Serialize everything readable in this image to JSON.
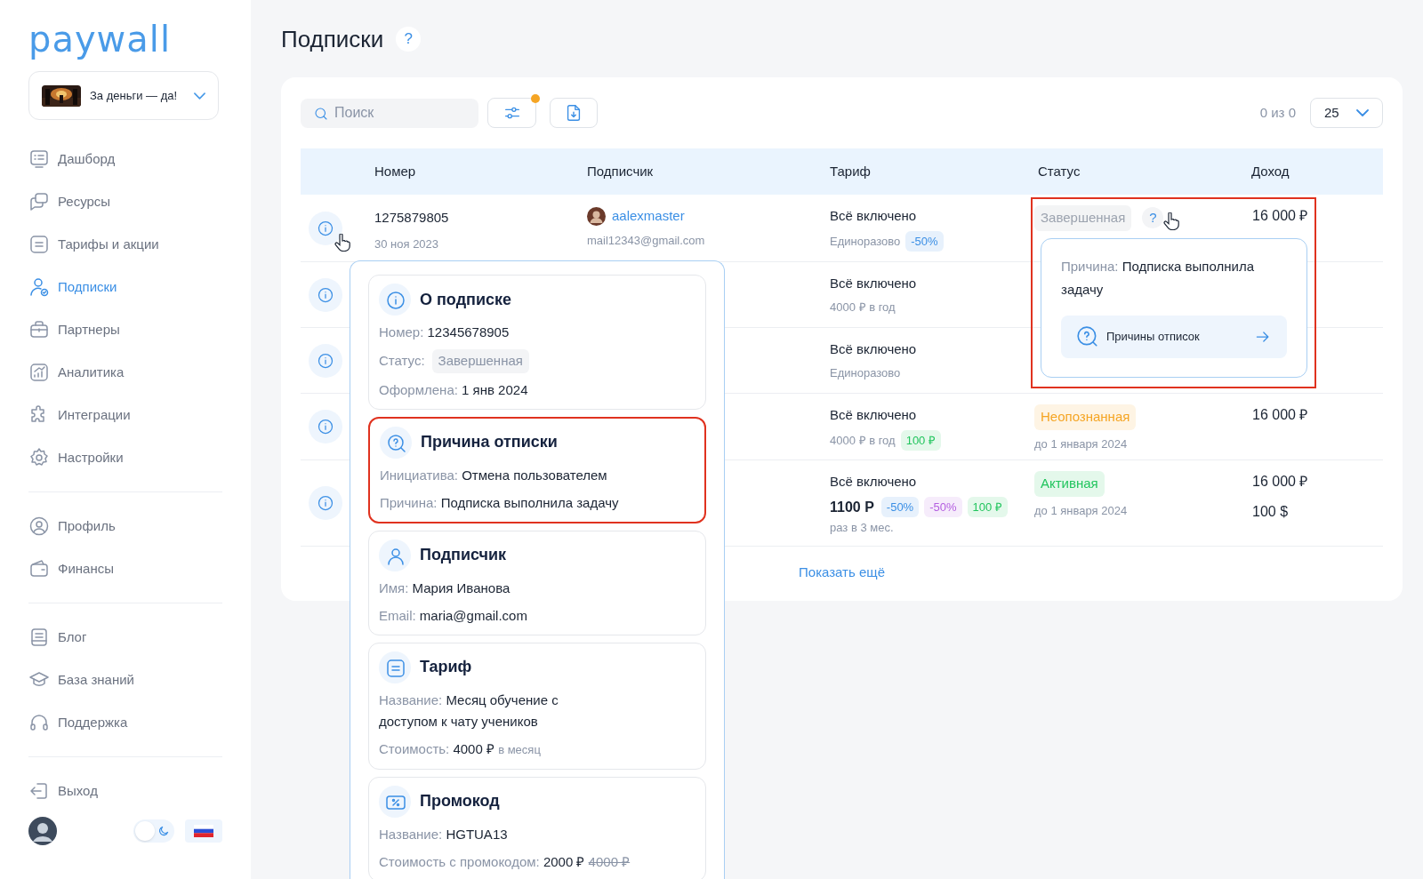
{
  "logo": "paywall",
  "project": {
    "name": "За деньги — да!"
  },
  "nav_groups": [
    [
      {
        "label": "Дашборд",
        "selected": false
      },
      {
        "label": "Ресурсы",
        "selected": false
      },
      {
        "label": "Тарифы и акции",
        "selected": false
      },
      {
        "label": "Подписки",
        "selected": true
      },
      {
        "label": "Партнеры",
        "selected": false
      },
      {
        "label": "Аналитика",
        "selected": false
      },
      {
        "label": "Интеграции",
        "selected": false
      },
      {
        "label": "Настройки",
        "selected": false
      }
    ],
    [
      {
        "label": "Профиль",
        "selected": false
      },
      {
        "label": "Финансы",
        "selected": false
      }
    ],
    [
      {
        "label": "Блог",
        "selected": false
      },
      {
        "label": "База знаний",
        "selected": false
      },
      {
        "label": "Поддержка",
        "selected": false
      }
    ],
    [
      {
        "label": "Выход",
        "selected": false
      }
    ]
  ],
  "footer": {
    "dark_mode": false
  },
  "page_title": "Подписки",
  "title_help": "?",
  "toolbar": {
    "search_placeholder": "Поиск",
    "filter_active": true,
    "count": "0 из 0",
    "page_size": "25"
  },
  "table": {
    "columns": [
      "Номер",
      "Подписчик",
      "Тариф",
      "Статус",
      "Доход"
    ],
    "rows": [
      {
        "hovered": true,
        "number": "1275879805",
        "date": "30 ноя 2023",
        "subscriber": {
          "name": "aalexmaster",
          "email": "mail12343@gmail.com"
        },
        "tariff": {
          "name": "Всё включено",
          "price": "Единоразово",
          "badges": [
            {
              "text": "-50%",
              "color": "#3b8fe5"
            }
          ]
        },
        "status": {
          "label": "Завершенная",
          "color": "#9ca3af",
          "help": "?",
          "help_hovered": true
        },
        "income": [
          "16 000 ₽"
        ]
      },
      {
        "tariff": {
          "name": "Всё включено",
          "price": "4000 ₽ в год"
        }
      },
      {
        "tariff": {
          "name": "Всё включено",
          "price": "Единоразово"
        }
      },
      {
        "tariff": {
          "name": "Всё включено",
          "price": "4000 ₽ в год",
          "badges": [
            {
              "text": "100 ₽",
              "color": "#22c55e"
            }
          ]
        },
        "status": {
          "label": "Неопознанная",
          "color": "#f5a524",
          "until": "до 1 января 2024"
        },
        "income": [
          "16 000 ₽"
        ]
      },
      {
        "tariff": {
          "name": "Всё включено",
          "amount": "1100 Р",
          "badges": [
            {
              "text": "-50%",
              "color": "#3b8fe5"
            },
            {
              "text": "-50%",
              "color": "#b45fe0"
            },
            {
              "text": "100 ₽",
              "color": "#22c55e"
            }
          ],
          "period": "раз в 3 мес."
        },
        "status": {
          "label": "Активная",
          "color": "#22c55e",
          "until": "до 1 января 2024"
        },
        "income": [
          "16 000 ₽",
          "100 $"
        ]
      }
    ]
  },
  "show_more": "Показать ещё",
  "details_popover": {
    "sections": [
      {
        "kind": "info",
        "title": "О подписке",
        "highlighted": false,
        "fields": [
          {
            "label": "Номер:",
            "value": "12345678905"
          },
          {
            "label": "Статус:",
            "badge": "Завершенная"
          },
          {
            "label": "Оформлена:",
            "value": "1 янв 2024"
          }
        ]
      },
      {
        "kind": "reason",
        "title": "Причина отписки",
        "highlighted": true,
        "fields": [
          {
            "label": "Инициатива:",
            "value": "Отмена пользователем"
          },
          {
            "label": "Причина:",
            "value": "Подписка выполнила задачу"
          }
        ]
      },
      {
        "kind": "user",
        "title": "Подписчик",
        "highlighted": false,
        "fields": [
          {
            "label": "Имя:",
            "value": "Мария Иванова"
          },
          {
            "label": "Email:",
            "value": "maria@gmail.com"
          }
        ]
      },
      {
        "kind": "tariff",
        "title": "Тариф",
        "highlighted": false,
        "fields": [
          {
            "label": "Название:",
            "value": "Месяц обучение с доступом к чату учеников"
          },
          {
            "label": "Стоимость:",
            "value": "4000 ₽",
            "note": "в месяц"
          }
        ]
      },
      {
        "kind": "promo",
        "title": "Промокод",
        "highlighted": false,
        "fields": [
          {
            "label": "Название:",
            "value": "HGTUA13"
          },
          {
            "label": "Стоимость с промокодом:",
            "value": "2000 ₽",
            "old_value": "4000 ₽"
          }
        ]
      }
    ]
  },
  "status_tooltip": {
    "highlighted": true,
    "label": "Причина:",
    "value": "Подписка выполнила задачу",
    "link": "Причины отписок"
  }
}
